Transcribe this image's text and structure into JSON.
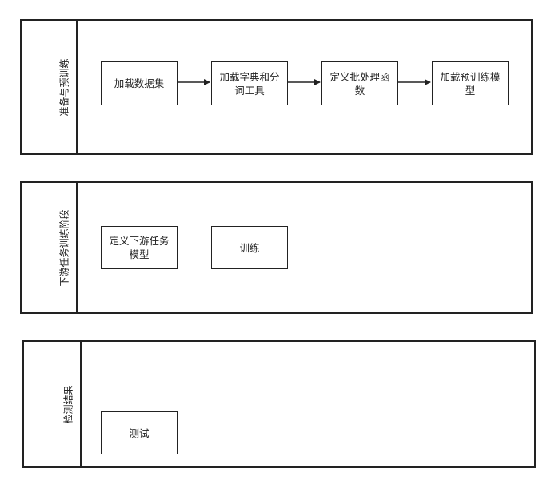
{
  "lanes": [
    {
      "title": "准备与预训练",
      "steps": [
        "加载数据集",
        "加载字典和分词工具",
        "定义批处理函数",
        "加载预训练模型"
      ]
    },
    {
      "title": "下游任务训练阶段",
      "steps": [
        "定义下游任务模型",
        "训练"
      ]
    },
    {
      "title": "检测结果",
      "steps": [
        "测试"
      ]
    }
  ]
}
